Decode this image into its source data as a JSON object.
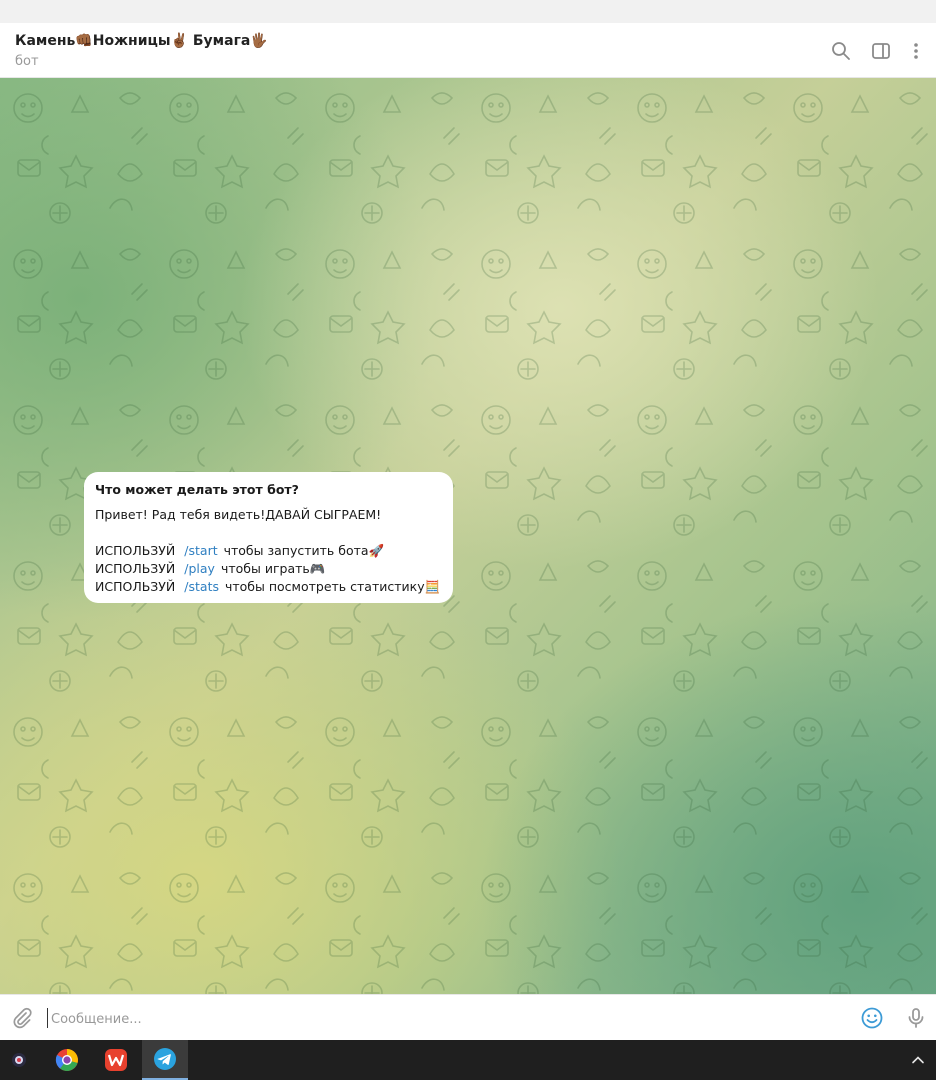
{
  "header": {
    "title": "Камень👊🏾Ножницы✌🏾 Бумага🖐🏾",
    "subtitle": "бот",
    "icons": [
      "search-icon",
      "sidebar-toggle-icon",
      "more-vertical-icon"
    ]
  },
  "bot_info": {
    "heading": "Что может делать этот бот?",
    "greeting": "Привет! Рад тебя видеть!ДАВАЙ СЫГРАЕМ!",
    "commands": [
      {
        "prefix": "ИСПОЛЬЗУЙ",
        "command": "/start",
        "text": "чтобы запустить бота🚀"
      },
      {
        "prefix": "ИСПОЛЬЗУЙ",
        "command": "/play",
        "text": "чтобы играть🎮"
      },
      {
        "prefix": "ИСПОЛЬЗУЙ",
        "command": "/stats",
        "text": "чтобы посмотреть статистику🧮"
      }
    ]
  },
  "composer": {
    "placeholder": "Сообщение...",
    "value": ""
  },
  "colors": {
    "link": "#2f7fc1",
    "accent": "#3d9bd6",
    "taskbar": "#1f1f1f"
  },
  "taskbar": {
    "apps": [
      "app-launcher-icon",
      "chrome-like-browser-icon",
      "wps-office-icon",
      "telegram-icon"
    ],
    "active": "telegram-icon"
  }
}
